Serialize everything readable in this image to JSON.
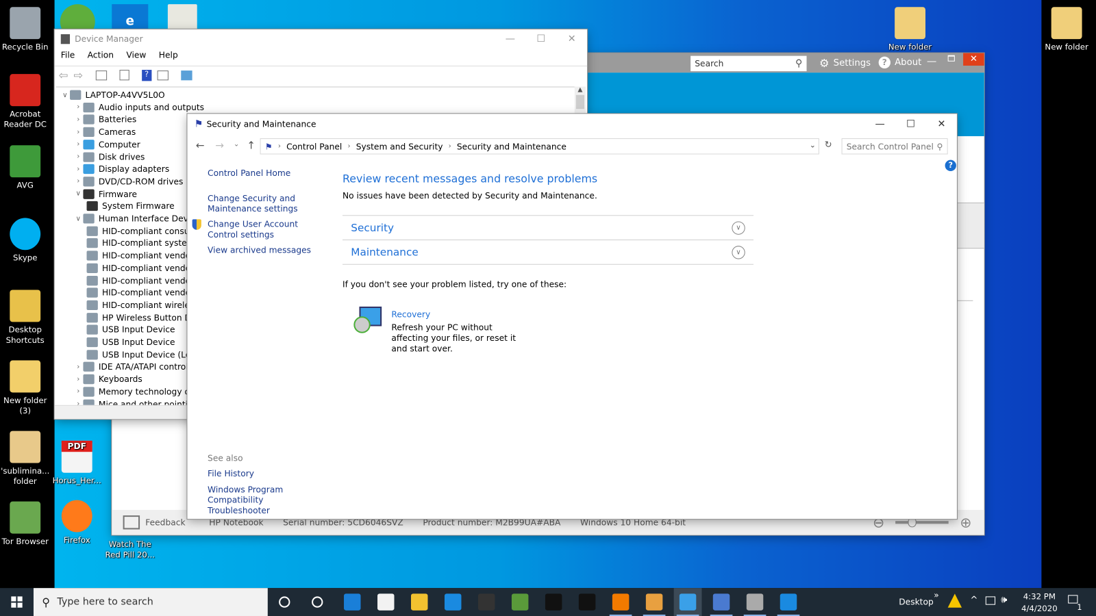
{
  "desktop": {
    "left_icons": [
      {
        "label": "Recycle Bin",
        "icon": "recycle-bin-icon",
        "color": "#9aa4ad"
      },
      {
        "label": "Acrobat Reader DC",
        "icon": "acrobat-icon",
        "color": "#d7261e"
      },
      {
        "label": "AVG",
        "icon": "avg-icon",
        "color": "#3e9a3a"
      },
      {
        "label": "Skype",
        "icon": "skype-icon",
        "color": "#00aff0"
      },
      {
        "label": "Desktop Shortcuts",
        "icon": "folder-icon",
        "color": "#e8c14a"
      },
      {
        "label": "New folder (3)",
        "icon": "folder-icon",
        "color": "#f2cf6a"
      },
      {
        "label": "'sublimina... folder",
        "icon": "folder-icon",
        "color": "#e8c98a"
      },
      {
        "label": "Tor Browser",
        "icon": "tor-folder-icon",
        "color": "#6aa84f"
      }
    ],
    "second_icons": [
      {
        "label": "Horus_Her...",
        "icon": "pdf-file-icon",
        "color": "#e0201c"
      },
      {
        "label": "Firefox",
        "icon": "firefox-icon",
        "color": "#ff7a1a"
      },
      {
        "label": "Watch The Red Pill 20...",
        "icon": "video-file-icon",
        "color": "#444"
      }
    ],
    "right_icons": [
      {
        "label": "New folder",
        "icon": "folder-icon",
        "color": "#f0cf7a"
      },
      {
        "label": "New folder",
        "icon": "folder-icon",
        "color": "#f0cf7a"
      }
    ],
    "pdf_badge": "PDF"
  },
  "hp_window": {
    "search_placeholder": "Search",
    "settings_label": "Settings",
    "about_label": "About",
    "feedback_label": "Feedback",
    "info": [
      "HP Notebook",
      "Serial number: 5CD6046SVZ",
      "Product number: M2B99UA#ABA",
      "Windows 10 Home 64-bit"
    ],
    "header_color": "#0096d6",
    "close_color": "#e0401a"
  },
  "device_manager": {
    "title": "Device Manager",
    "menu": [
      "File",
      "Action",
      "View",
      "Help"
    ],
    "tree": [
      {
        "label": "LAPTOP-A4VV5L0O",
        "level": 0,
        "state": "open",
        "icon": "computer-icon"
      },
      {
        "label": "Audio inputs and outputs",
        "level": 1,
        "state": "closed",
        "icon": "speaker-icon"
      },
      {
        "label": "Batteries",
        "level": 1,
        "state": "closed",
        "icon": "battery-icon"
      },
      {
        "label": "Cameras",
        "level": 1,
        "state": "closed",
        "icon": "camera-icon"
      },
      {
        "label": "Computer",
        "level": 1,
        "state": "closed",
        "icon": "monitor-icon"
      },
      {
        "label": "Disk drives",
        "level": 1,
        "state": "closed",
        "icon": "disk-icon"
      },
      {
        "label": "Display adapters",
        "level": 1,
        "state": "closed",
        "icon": "display-adapter-icon"
      },
      {
        "label": "DVD/CD-ROM drives",
        "level": 1,
        "state": "closed",
        "icon": "dvd-icon"
      },
      {
        "label": "Firmware",
        "level": 1,
        "state": "open",
        "icon": "chip-icon"
      },
      {
        "label": "System Firmware",
        "level": 2,
        "state": "leaf",
        "icon": "chip-icon"
      },
      {
        "label": "Human Interface Devices",
        "level": 1,
        "state": "open",
        "icon": "hid-icon"
      },
      {
        "label": "HID-compliant consumer control device",
        "level": 2,
        "state": "leaf",
        "icon": "hid-icon"
      },
      {
        "label": "HID-compliant system controller",
        "level": 2,
        "state": "leaf",
        "icon": "hid-icon"
      },
      {
        "label": "HID-compliant vendor-defined device",
        "level": 2,
        "state": "leaf",
        "icon": "hid-icon"
      },
      {
        "label": "HID-compliant vendor-defined device",
        "level": 2,
        "state": "leaf",
        "icon": "hid-icon"
      },
      {
        "label": "HID-compliant vendor-defined device",
        "level": 2,
        "state": "leaf",
        "icon": "hid-icon"
      },
      {
        "label": "HID-compliant vendor-defined device",
        "level": 2,
        "state": "leaf",
        "icon": "hid-icon"
      },
      {
        "label": "HID-compliant wireless radio controls",
        "level": 2,
        "state": "leaf",
        "icon": "hid-icon"
      },
      {
        "label": "HP Wireless Button Driver",
        "level": 2,
        "state": "leaf",
        "icon": "hid-icon"
      },
      {
        "label": "USB Input Device",
        "level": 2,
        "state": "leaf",
        "icon": "hid-icon"
      },
      {
        "label": "USB Input Device",
        "level": 2,
        "state": "leaf",
        "icon": "hid-icon"
      },
      {
        "label": "USB Input Device (Logitech Download Assistant)",
        "level": 2,
        "state": "leaf",
        "icon": "hid-icon"
      },
      {
        "label": "IDE ATA/ATAPI controllers",
        "level": 1,
        "state": "closed",
        "icon": "ide-icon"
      },
      {
        "label": "Keyboards",
        "level": 1,
        "state": "closed",
        "icon": "keyboard-icon"
      },
      {
        "label": "Memory technology devices",
        "level": 1,
        "state": "closed",
        "icon": "memory-icon"
      },
      {
        "label": "Mice and other pointing devices",
        "level": 1,
        "state": "closed",
        "icon": "mouse-icon"
      }
    ]
  },
  "security": {
    "title": "Security and Maintenance",
    "breadcrumb": [
      "Control Panel",
      "System and Security",
      "Security and Maintenance"
    ],
    "search_placeholder": "Search Control Panel",
    "sidebar": {
      "home": "Control Panel Home",
      "links": [
        "Change Security and Maintenance settings",
        "Change User Account Control settings",
        "View archived messages"
      ],
      "see_also_title": "See also",
      "see_also": [
        "File History",
        "Windows Program Compatibility Troubleshooter"
      ]
    },
    "heading": "Review recent messages and resolve problems",
    "subtext": "No issues have been detected by Security and Maintenance.",
    "sections": [
      "Security",
      "Maintenance"
    ],
    "try_text": "If you don't see your problem listed, try one of these:",
    "recovery": {
      "title": "Recovery",
      "desc": "Refresh your PC without affecting your files, or reset it and start over."
    },
    "accent": "#1e6fd6"
  },
  "taskbar": {
    "search_placeholder": "Type here to search",
    "apps": [
      "cortana-icon",
      "task-view-icon",
      "edge-icon",
      "store-icon",
      "file-explorer-icon",
      "mail-icon",
      "amazon-icon",
      "tripadvisor-icon",
      "camera-app-icon",
      "color-app-icon",
      "vlc-icon",
      "paint-icon",
      "control-panel-icon",
      "device-manager-icon",
      "hp-support-icon",
      "help-icon"
    ],
    "desktop_label": "Desktop",
    "time": "4:32 PM",
    "date": "4/4/2020",
    "notification_count": "1"
  }
}
